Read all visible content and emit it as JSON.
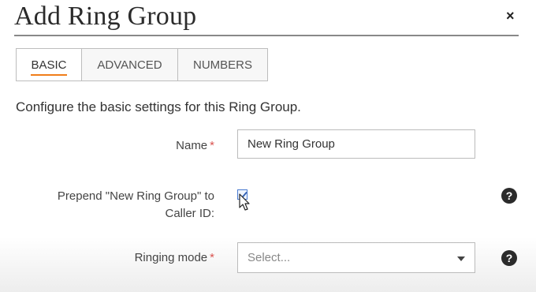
{
  "dialog": {
    "title": "Add Ring Group",
    "close_glyph": "×"
  },
  "tabs": [
    {
      "label": "BASIC",
      "active": true
    },
    {
      "label": "ADVANCED",
      "active": false
    },
    {
      "label": "NUMBERS",
      "active": false
    }
  ],
  "intro": "Configure the basic settings for this Ring Group.",
  "form": {
    "name": {
      "label": "Name",
      "required_mark": "*",
      "value": "New Ring Group"
    },
    "prepend": {
      "label": "Prepend \"New Ring Group\" to Caller ID:",
      "checked": true,
      "help_glyph": "?"
    },
    "ringing_mode": {
      "label": "Ringing mode",
      "required_mark": "*",
      "placeholder": "Select...",
      "help_glyph": "?"
    }
  },
  "colors": {
    "accent": "#f07d1a",
    "required": "#d9534f",
    "checkbox": "#4a7bd0"
  },
  "icons": {
    "close": "close-icon",
    "help": "help-icon",
    "caret": "chevron-down-icon",
    "cursor": "mouse-pointer-icon"
  }
}
